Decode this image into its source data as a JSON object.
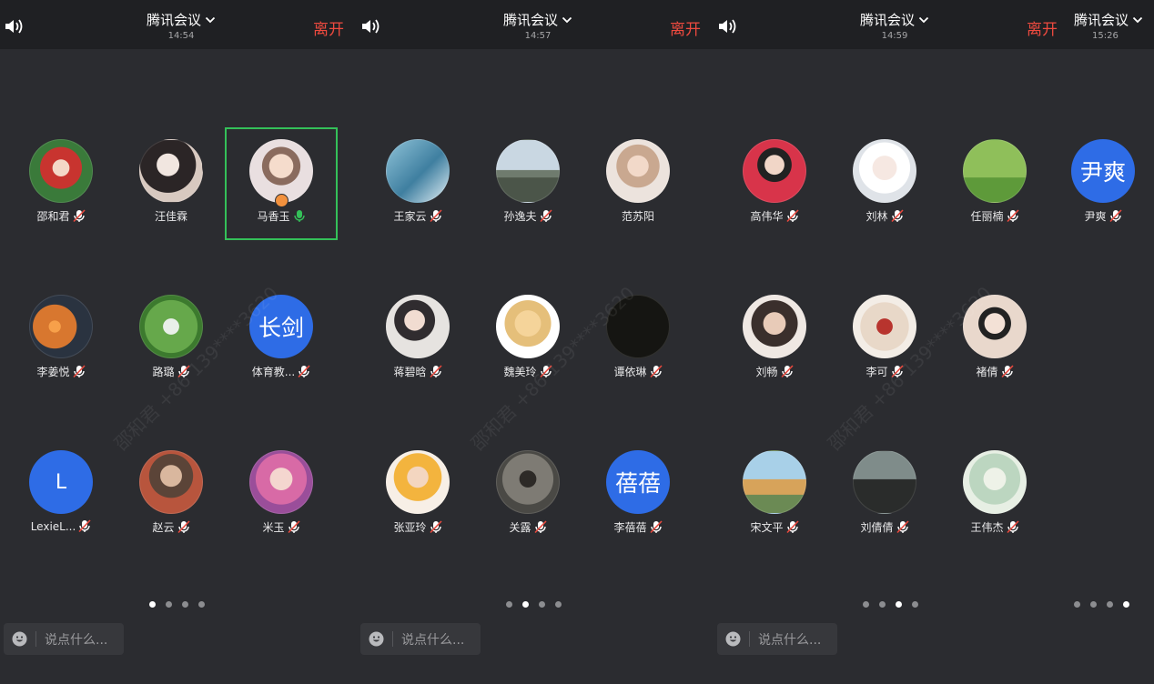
{
  "watermark": "邵和君 +86 139****3620",
  "panels": [
    {
      "title": "腾讯会议",
      "time": "14:54",
      "leave_label": "离开",
      "chat_placeholder": "说点什么...",
      "page_dots": [
        true,
        false,
        false,
        false
      ],
      "participants": [
        {
          "name": "邵和君",
          "mic": "muted"
        },
        {
          "name": "汪佳霖",
          "mic": "none"
        },
        {
          "name": "马香玉",
          "mic": "speaking",
          "active": true,
          "host": true
        },
        {
          "name": "李姜悦",
          "mic": "muted"
        },
        {
          "name": "路璐",
          "mic": "muted"
        },
        {
          "name": "体育教...",
          "mic": "muted",
          "initials": "长剑",
          "color": "#2e6ce6"
        },
        {
          "name": "LexieL...",
          "mic": "muted",
          "initials": "L",
          "color": "#2e6ce6"
        },
        {
          "name": "赵云",
          "mic": "muted"
        },
        {
          "name": "米玉",
          "mic": "muted"
        }
      ]
    },
    {
      "title": "腾讯会议",
      "time": "14:57",
      "leave_label": "离开",
      "chat_placeholder": "说点什么...",
      "page_dots": [
        false,
        true,
        false,
        false
      ],
      "participants": [
        {
          "name": "王家云",
          "mic": "muted"
        },
        {
          "name": "孙逸夫",
          "mic": "muted"
        },
        {
          "name": "范苏阳",
          "mic": "none"
        },
        {
          "name": "蒋碧晗",
          "mic": "muted"
        },
        {
          "name": "魏美玲",
          "mic": "muted"
        },
        {
          "name": "谭依琳",
          "mic": "muted"
        },
        {
          "name": "张亚玲",
          "mic": "muted"
        },
        {
          "name": "关露",
          "mic": "muted"
        },
        {
          "name": "李蓓蓓",
          "mic": "muted",
          "initials": "蓓蓓",
          "color": "#2e6ce6"
        }
      ]
    },
    {
      "title": "腾讯会议",
      "time": "14:59",
      "leave_label": "离开",
      "chat_placeholder": "说点什么...",
      "page_dots": [
        false,
        false,
        true,
        false
      ],
      "participants": [
        {
          "name": "高伟华",
          "mic": "muted"
        },
        {
          "name": "刘林",
          "mic": "muted"
        },
        {
          "name": "任丽楠",
          "mic": "muted"
        },
        {
          "name": "刘畅",
          "mic": "muted"
        },
        {
          "name": "李可",
          "mic": "muted"
        },
        {
          "name": "褚倩",
          "mic": "muted"
        },
        {
          "name": "宋文平",
          "mic": "muted"
        },
        {
          "name": "刘倩倩",
          "mic": "muted"
        },
        {
          "name": "王伟杰",
          "mic": "muted"
        }
      ]
    },
    {
      "title": "腾讯会议",
      "time": "15:26",
      "page_dots": [
        false,
        false,
        false,
        true
      ],
      "participants": [
        {
          "name": "尹爽",
          "mic": "muted",
          "initials": "尹爽",
          "color": "#2e6ce6"
        }
      ]
    }
  ]
}
